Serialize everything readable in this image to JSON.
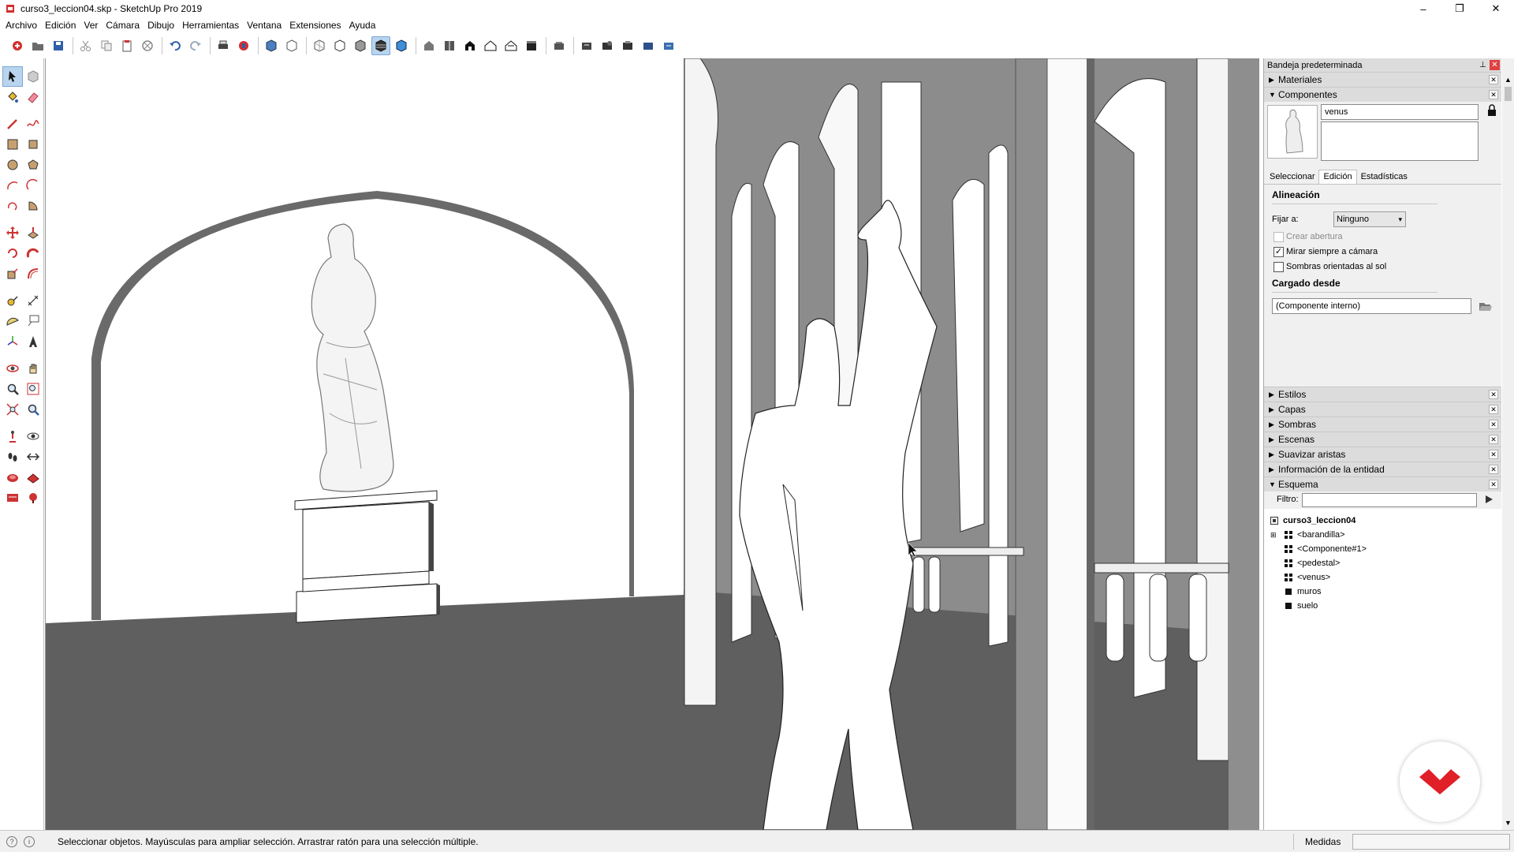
{
  "window": {
    "title": "curso3_leccion04.skp - SketchUp Pro 2019",
    "minimize": "–",
    "restore": "❐",
    "close": "✕"
  },
  "menu": [
    "Archivo",
    "Edición",
    "Ver",
    "Cámara",
    "Dibujo",
    "Herramientas",
    "Ventana",
    "Extensiones",
    "Ayuda"
  ],
  "tray": {
    "title": "Bandeja predeterminada",
    "panels_top": [
      {
        "label": "Materiales",
        "expanded": false
      },
      {
        "label": "Componentes",
        "expanded": true
      }
    ],
    "components": {
      "name_value": "venus",
      "tabs": [
        "Seleccionar",
        "Edición",
        "Estadísticas"
      ],
      "active_tab": "Edición",
      "alignment_title": "Alineación",
      "glue_label": "Fijar a:",
      "glue_value": "Ninguno",
      "cut_opening": "Crear abertura",
      "face_camera": "Mirar siempre a cámara",
      "face_camera_checked": true,
      "shadows_sun": "Sombras orientadas al sol",
      "shadows_sun_checked": false,
      "loaded_from_title": "Cargado desde",
      "loaded_from_value": "(Componente interno)"
    },
    "panels_bottom": [
      {
        "label": "Estilos",
        "expanded": false
      },
      {
        "label": "Capas",
        "expanded": false
      },
      {
        "label": "Sombras",
        "expanded": false
      },
      {
        "label": "Escenas",
        "expanded": false
      },
      {
        "label": "Suavizar aristas",
        "expanded": false
      },
      {
        "label": "Información de la entidad",
        "expanded": false
      },
      {
        "label": "Esquema",
        "expanded": true
      }
    ],
    "outliner": {
      "filter_label": "Filtro:",
      "root": "curso3_leccion04",
      "items": [
        {
          "label": "<barandilla>",
          "type": "component",
          "expandable": true
        },
        {
          "label": "<Componente#1>",
          "type": "component",
          "expandable": false
        },
        {
          "label": "<pedestal>",
          "type": "component",
          "expandable": false
        },
        {
          "label": "<venus>",
          "type": "component",
          "expandable": false
        },
        {
          "label": "muros",
          "type": "group",
          "expandable": false
        },
        {
          "label": "suelo",
          "type": "group",
          "expandable": false
        }
      ]
    }
  },
  "status": {
    "message": "Seleccionar objetos. Mayúsculas para ampliar selección. Arrastrar ratón para una selección múltiple.",
    "measurements_label": "Medidas",
    "measurements_value": ""
  },
  "colors": {
    "floor": "#5f5f5f",
    "wall_gray": "#8a8a8a",
    "logo_red": "#e01f26",
    "highlight": "#b9d4ee"
  }
}
